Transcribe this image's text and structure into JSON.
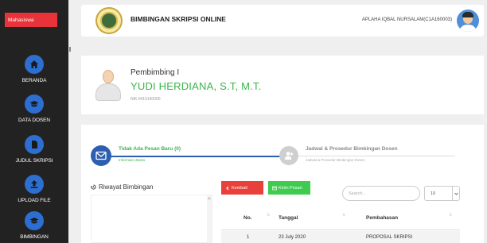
{
  "sidebar": {
    "brand": "Mahasiswa",
    "items": [
      {
        "label": "BERANDA",
        "icon": "home-icon"
      },
      {
        "label": "DATA DOSEN",
        "icon": "graduation-cap-icon"
      },
      {
        "label": "JUDUL SKRIPSI",
        "icon": "file-icon"
      },
      {
        "label": "UPLOAD FILE",
        "icon": "upload-icon"
      },
      {
        "label": "BIMBINGAN",
        "icon": "graduation-cap-icon"
      }
    ]
  },
  "header": {
    "title": "BIMBINGAN SKRIPSI ONLINE",
    "user": "APLAHA IQBAL NURSALAM(C1A160003)"
  },
  "advisor": {
    "role": "Pembimbing I",
    "name": "YUDI HERDIANA, S.T, M.T.",
    "nid": "NIK.0410160000"
  },
  "steps": [
    {
      "title": "Tidak Ada Pesan Baru (0)",
      "subtitle": "Informasi Utama"
    },
    {
      "title": "Jadwal & Prosedur Bimbingan Dosen",
      "subtitle": "Jadwal & Prosedur Bimbingan Dosen"
    }
  ],
  "history": {
    "title": "Riwayat Bimbingan"
  },
  "buttons": {
    "back": "Kembali",
    "send": "Kirim Pesan"
  },
  "table": {
    "search_placeholder": "Search...",
    "page_size": "10",
    "columns": [
      "No.",
      "Tanggal",
      "Pembahasan"
    ],
    "rows": [
      {
        "no": "1",
        "tanggal": "23 July 2020",
        "pembahasan": "PROPOSAL SKRIPSI"
      }
    ]
  },
  "colors": {
    "sidebar_bg": "#222222",
    "brand_red": "#e8333a",
    "accent_blue": "#2d5fb0",
    "accent_green": "#3ab54a"
  }
}
